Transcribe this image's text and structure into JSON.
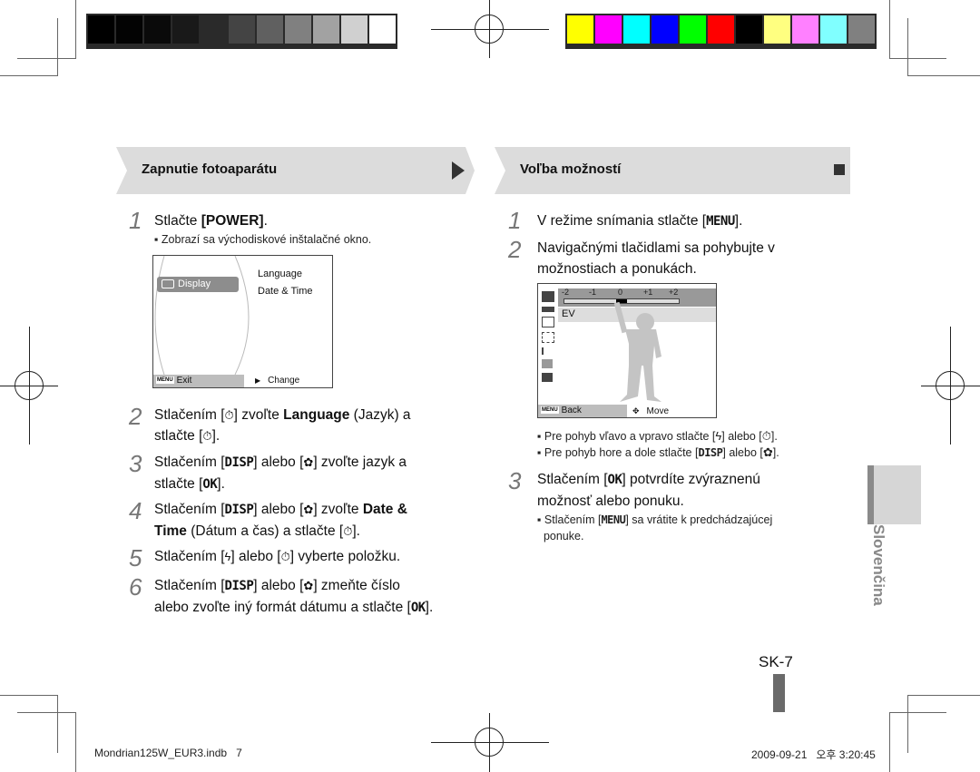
{
  "print_marks": {
    "grayscale_swatches": [
      "#000000",
      "#030303",
      "#0a0a0a",
      "#191919",
      "#2a2a2a",
      "#444444",
      "#606060",
      "#808080",
      "#a2a2a2",
      "#d0d0d0",
      "#ffffff"
    ],
    "color_swatches": [
      "#ffff00",
      "#ff00ff",
      "#00ffff",
      "#0000ff",
      "#00ff00",
      "#ff0000",
      "#000000",
      "#ffff80",
      "#ff80ff",
      "#80ffff",
      "#808080"
    ]
  },
  "left_section": {
    "title": "Zapnutie fotoaparátu",
    "steps": [
      {
        "num": "1",
        "text_parts": [
          "Stlačte ",
          "[POWER]",
          "."
        ],
        "bullet": "Zobrazí sa východiskové inštalačné okno."
      },
      {
        "num": "2",
        "line1": [
          "Stlačením [",
          "] zvoľte ",
          "Language",
          " (Jazyk) a"
        ],
        "line2": [
          "stlačte [",
          "]."
        ]
      },
      {
        "num": "3",
        "line1": [
          "Stlačením [",
          "DISP",
          "] alebo [",
          "] zvoľte jazyk a"
        ],
        "line2": [
          "stlačte [",
          "OK",
          "]."
        ]
      },
      {
        "num": "4",
        "line1": [
          "Stlačením [",
          "DISP",
          "] alebo [",
          "] zvoľte ",
          "Date &"
        ],
        "line2": [
          "Time",
          " (Dátum a čas) a stlačte [",
          "]."
        ]
      },
      {
        "num": "5",
        "line1": [
          "Stlačením [",
          "] alebo [",
          "] vyberte položku."
        ]
      },
      {
        "num": "6",
        "line1": [
          "Stlačením [",
          "DISP",
          "] alebo [",
          "] zmeňte číslo"
        ],
        "line2": [
          "alebo zvoľte iný formát dátumu a stlačte [",
          "OK",
          "]."
        ]
      }
    ],
    "screen": {
      "menu_item": "Display",
      "options": [
        "Language",
        "Date & Time"
      ],
      "footer_menu_tag": "MENU",
      "footer_left": "Exit",
      "footer_right": "Change"
    }
  },
  "right_section": {
    "title": "Voľba možností",
    "steps": [
      {
        "num": "1",
        "text_parts": [
          "V režime snímania stlačte [",
          "MENU",
          "]."
        ]
      },
      {
        "num": "2",
        "line1": "Navigačnými tlačidlami sa pohybujte v",
        "line2": "možnostiach a ponukách."
      },
      {
        "num": "3",
        "line1": [
          "Stlačením [",
          "OK",
          "] potvrdíte zvýraznenú"
        ],
        "line2": "možnosť alebo ponuku.",
        "bullet_line1": [
          "Stlačením [",
          "MENU",
          "] sa vrátite k predchádzajúcej"
        ],
        "bullet_line2": "ponuke."
      }
    ],
    "bullets_after_2": [
      {
        "parts": [
          "Pre pohyb vľavo a vpravo stlačte [",
          "] alebo [",
          "]."
        ]
      },
      {
        "parts": [
          "Pre pohyb hore a dole stlačte [",
          "DISP",
          "] alebo [",
          "]."
        ]
      }
    ],
    "screen": {
      "ev_scale": [
        "-2",
        "-1",
        "0",
        "+1",
        "+2"
      ],
      "ev_value": 0,
      "selected_label": "EV",
      "footer_menu_tag": "MENU",
      "footer_left": "Back",
      "footer_right": "Move"
    }
  },
  "side_tab": {
    "label": "Slovenčina"
  },
  "page_number": "SK-7",
  "footer": {
    "file": "Mondrian125W_EUR3.indb   7",
    "timestamp": "2009-09-21   오후 3:20:45"
  }
}
